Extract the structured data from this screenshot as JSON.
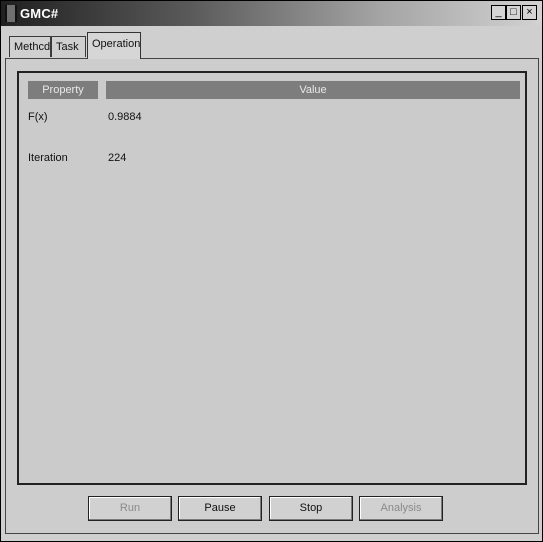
{
  "window": {
    "title": "GMC#",
    "controls": {
      "minimize": "_",
      "maximize": "□",
      "close": "×"
    }
  },
  "tabs": [
    {
      "label": "Methcd",
      "active": false
    },
    {
      "label": "Task",
      "active": false
    },
    {
      "label": "Operation",
      "active": true
    }
  ],
  "grid": {
    "headers": {
      "property": "Property",
      "value": "Value"
    },
    "rows": [
      {
        "property": "F(x)",
        "value": "0.9884"
      },
      {
        "property": "Iteration",
        "value": "224"
      }
    ]
  },
  "buttons": {
    "run": "Run",
    "pause": "Pause",
    "stop": "Stop",
    "analysis": "Analysis"
  },
  "colors": {
    "header_bg": "#7d7d7d",
    "panel_bg": "#cdcdcd",
    "disabled_text": "#8a8a8a"
  }
}
